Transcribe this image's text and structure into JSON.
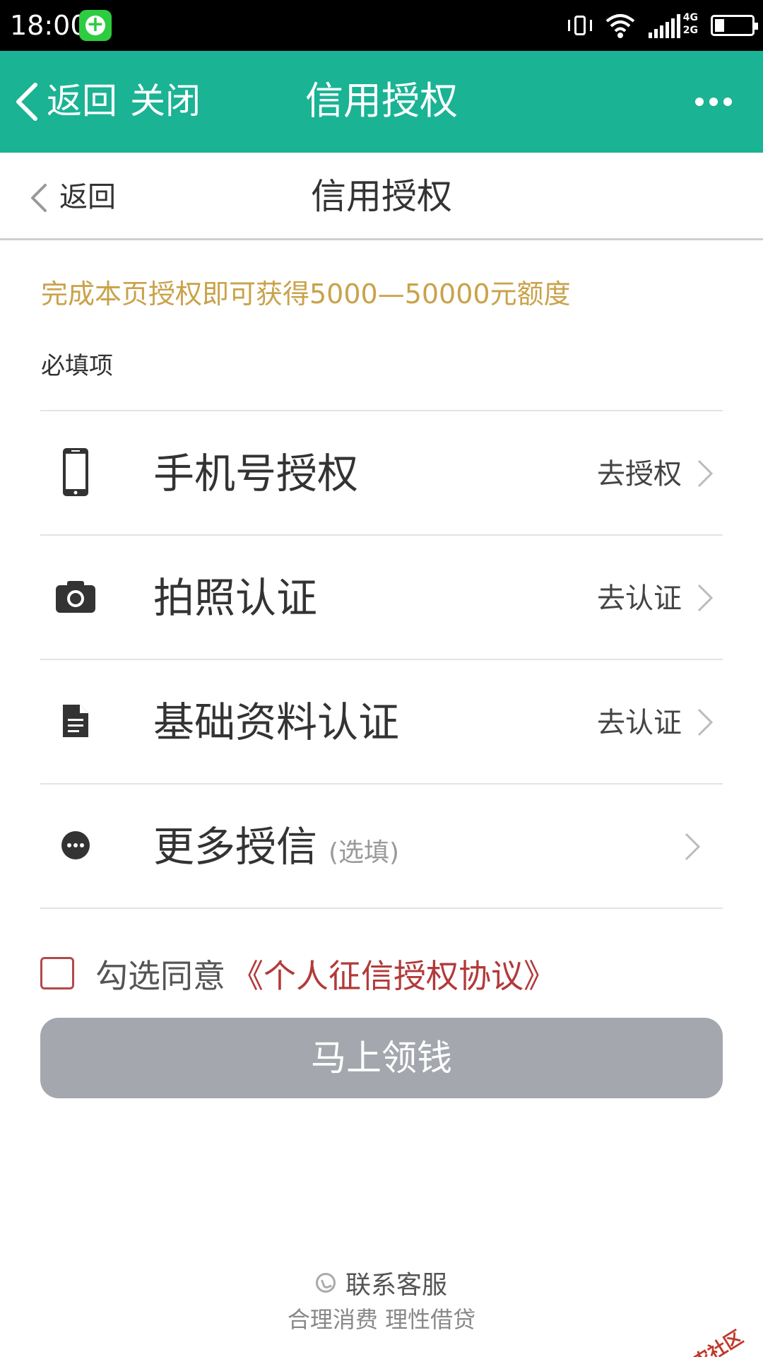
{
  "status_bar": {
    "time": "18:00",
    "network_label_top": "4G",
    "network_label_bottom": "2G",
    "battery_level": 0.25,
    "icons": [
      "messenger-app-icon",
      "vibrate-icon",
      "wifi-icon",
      "signal-icon",
      "battery-icon"
    ]
  },
  "app_header": {
    "back_label": "返回",
    "close_label": "关闭",
    "title": "信用授权",
    "more_icon": "more-dots-icon",
    "background_color": "#1ab394"
  },
  "sub_nav": {
    "back_label": "返回",
    "title": "信用授权"
  },
  "promo_text": "完成本页授权即可获得5000—50000元额度",
  "section_label": "必填项",
  "items": [
    {
      "icon": "phone-icon",
      "label": "手机号授权",
      "action": "去授权",
      "optional": ""
    },
    {
      "icon": "camera-icon",
      "label": "拍照认证",
      "action": "去认证",
      "optional": ""
    },
    {
      "icon": "document-icon",
      "label": "基础资料认证",
      "action": "去认证",
      "optional": ""
    },
    {
      "icon": "more-circle-icon",
      "label": "更多授信",
      "action": "",
      "optional": "(选填)"
    }
  ],
  "agreement": {
    "prefix": "勾选同意",
    "link": "《个人征信授权协议》",
    "checked": false
  },
  "submit_button": "马上领钱",
  "footer": {
    "service": "联系客服",
    "slogan": "合理消费 理性借贷"
  },
  "watermark": "卡农社区",
  "colors": {
    "accent": "#1ab394",
    "promo": "#c9a24a",
    "link": "#b23a3a",
    "button_disabled": "#a4a8ae"
  }
}
